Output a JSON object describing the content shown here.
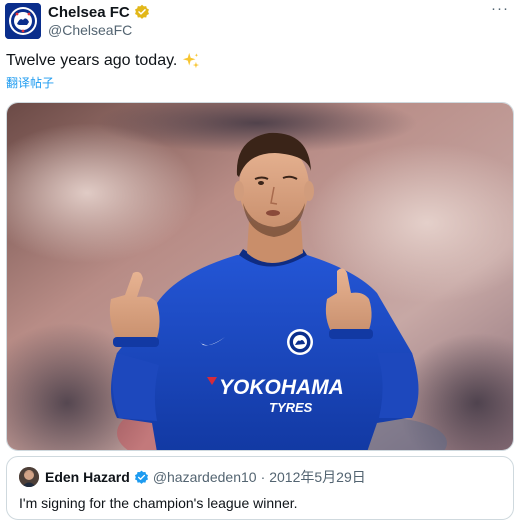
{
  "post": {
    "author": {
      "display_name": "Chelsea FC",
      "handle": "@ChelseaFC",
      "verified": true,
      "verified_color": "#e2b719"
    },
    "more_label": "···",
    "text": "Twelve years ago today.",
    "emoji": "sparkles-icon",
    "translate_label": "翻译帖子",
    "media": {
      "jersey_sponsor": "YOKOHAMA",
      "jersey_sponsor_sub": "TYRES",
      "jersey_color": "#1a4bc4"
    }
  },
  "quoted": {
    "display_name": "Eden Hazard",
    "handle": "@hazardeden10",
    "separator": "·",
    "date": "2012年5月29日",
    "verified": true,
    "verified_color": "#1d9bf0",
    "text": "I'm signing for the champion's league winner."
  }
}
